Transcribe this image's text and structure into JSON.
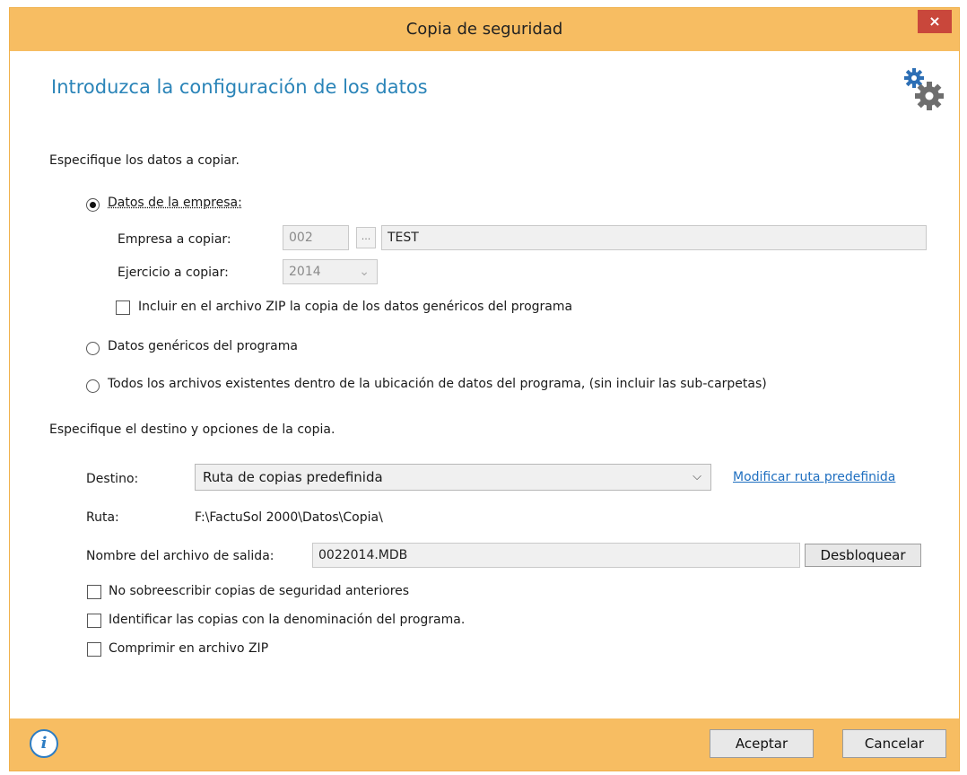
{
  "window": {
    "title": "Copia de seguridad",
    "close": "×"
  },
  "heading": "Introduzca la configuración de los datos",
  "section1": {
    "label": "Especifique los datos a copiar.",
    "options": {
      "empresa": "Datos de la empresa:",
      "genericos": "Datos genéricos del programa",
      "todos": "Todos los archivos existentes dentro de la ubicación de datos del programa, (sin incluir las sub-carpetas)"
    },
    "selected": "empresa",
    "empresa_label": "Empresa a copiar:",
    "empresa_code": "002",
    "browse": "...",
    "empresa_name": "TEST",
    "ejercicio_label": "Ejercicio a copiar:",
    "ejercicio_value": "2014",
    "zip_generic": "Incluir en el archivo ZIP la copia de los datos genéricos del programa"
  },
  "section2": {
    "label": "Especifique el destino y opciones de la copia.",
    "destino_label": "Destino:",
    "destino_value": "Ruta de copias predefinida",
    "modify_link": "Modificar ruta predefinida",
    "ruta_label": "Ruta:",
    "ruta_value": "F:\\FactuSol 2000\\Datos\\Copia\\",
    "filename_label": "Nombre del archivo de salida:",
    "filename_value": "0022014.MDB",
    "unlock": "Desbloquear",
    "opt_no_overwrite": "No sobreescribir copias de seguridad anteriores",
    "opt_identify": "Identificar las copias con la denominación del programa.",
    "opt_zip": "Comprimir en archivo ZIP"
  },
  "footer": {
    "info_icon": "i",
    "accept": "Aceptar",
    "cancel": "Cancelar"
  },
  "colors": {
    "accent": "#f7bd62",
    "heading": "#2a84b8",
    "close": "#c9473b",
    "link": "#1f6fc0"
  }
}
